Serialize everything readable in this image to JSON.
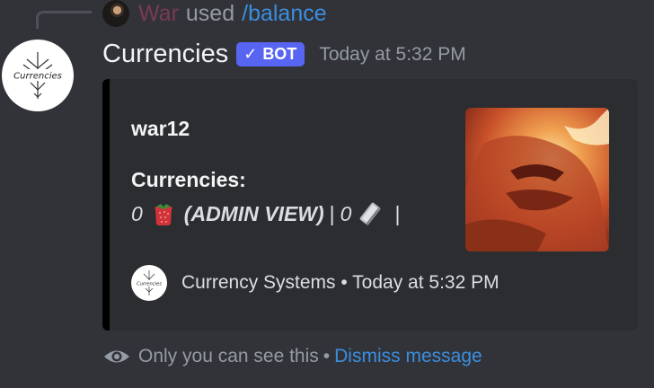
{
  "reply": {
    "username": "War",
    "used_text": "used",
    "command": "/balance"
  },
  "message": {
    "author": "Currencies",
    "bot_tag": "BOT",
    "timestamp": "Today at 5:32 PM",
    "avatar_text": "Currencies"
  },
  "embed": {
    "title": "war12",
    "field_name": "Currencies:",
    "value_amount_1": "0",
    "admin_view": "(ADMIN VIEW)",
    "separator": "|",
    "value_amount_2": "0",
    "separator_end": "|",
    "footer_icon_text": "Currencies",
    "footer_text": "Currency Systems • Today at 5:32 PM"
  },
  "ephemeral": {
    "notice": "Only you can see this",
    "dot": "•",
    "dismiss": "Dismiss message"
  },
  "colors": {
    "background": "#313338",
    "embed_background": "#2b2d31",
    "embed_border": "#000000",
    "bot_tag": "#5865f2",
    "link": "#3b8ee0",
    "username_reply": "#7a3a53"
  },
  "icons": {
    "verified": "check-icon",
    "strawberry": "strawberry-icon",
    "silver_bar": "silver-bar-icon",
    "eye": "eye-icon"
  }
}
